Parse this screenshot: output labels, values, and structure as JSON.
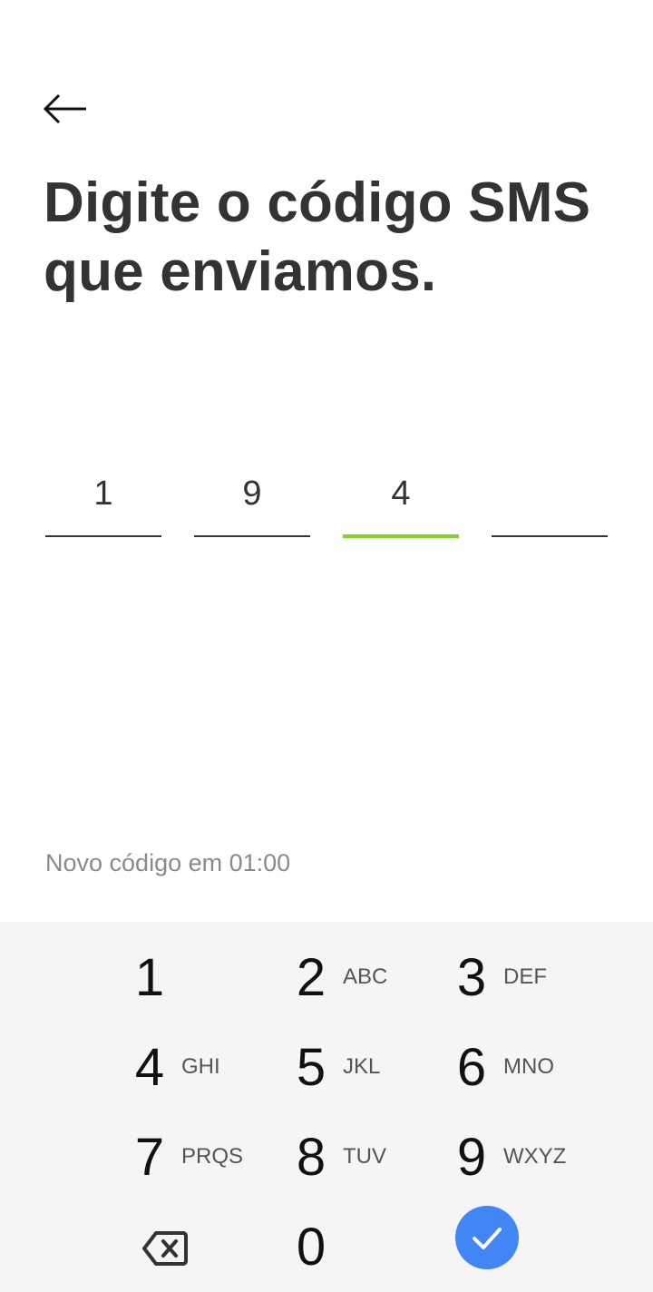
{
  "header": {
    "back_icon": "arrow-left-icon",
    "title_line1": "Digite o código SMS",
    "title_line2": "que enviamos."
  },
  "code": {
    "digits": [
      "1",
      "9",
      "4",
      ""
    ],
    "active_index": 2,
    "active_color": "#82d22a"
  },
  "timer": {
    "text": "Novo código em 01:00"
  },
  "keypad": {
    "keys": [
      {
        "num": "1",
        "letters": ""
      },
      {
        "num": "2",
        "letters": "ABC"
      },
      {
        "num": "3",
        "letters": "DEF"
      },
      {
        "num": "4",
        "letters": "GHI"
      },
      {
        "num": "5",
        "letters": "JKL"
      },
      {
        "num": "6",
        "letters": "MNO"
      },
      {
        "num": "7",
        "letters": "PRQS"
      },
      {
        "num": "8",
        "letters": "TUV"
      },
      {
        "num": "9",
        "letters": "WXYZ"
      },
      {
        "num": "0",
        "letters": ""
      }
    ],
    "backspace_icon": "backspace-icon",
    "confirm_icon": "check-icon",
    "confirm_color": "#4285f4"
  }
}
